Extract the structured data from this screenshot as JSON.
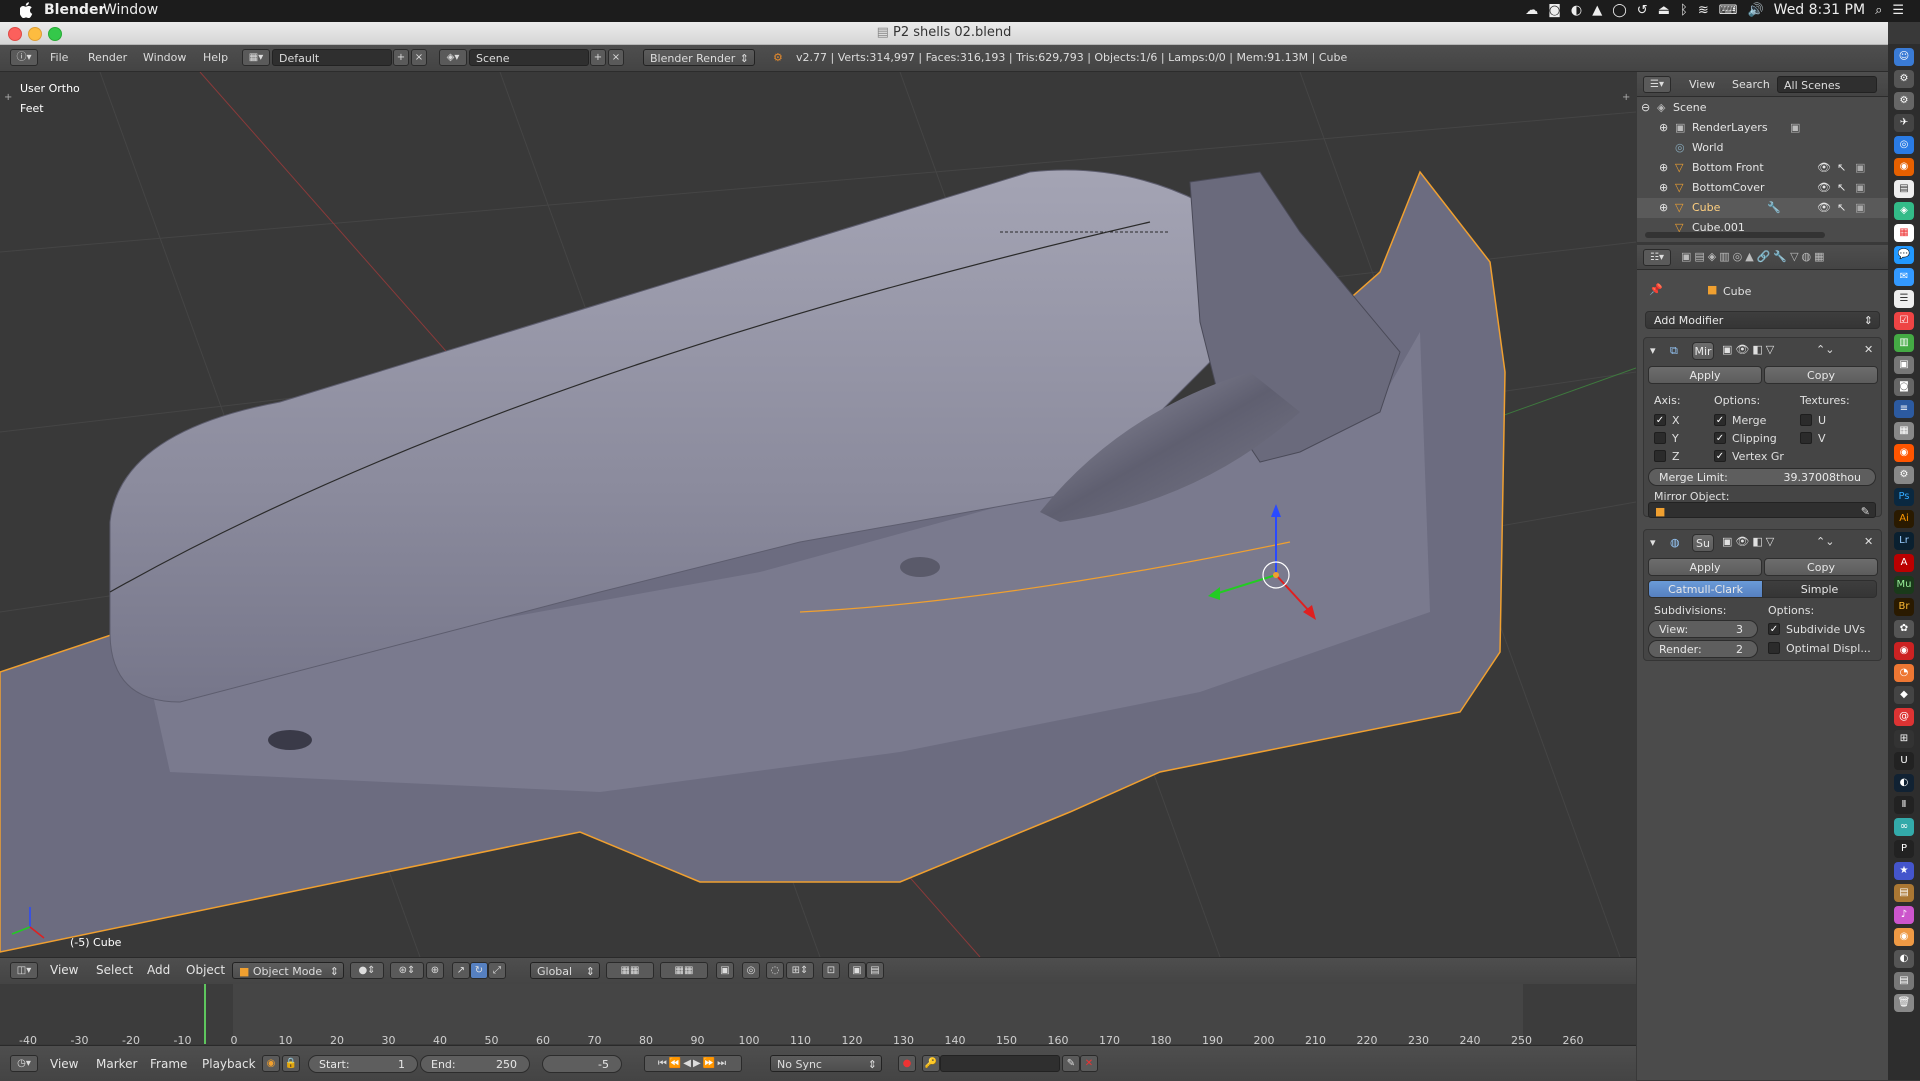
{
  "mac_menubar": {
    "apple": "",
    "app": "Blender",
    "window_menu": "Window",
    "clock": "Wed 8:31 PM"
  },
  "window": {
    "title": "P2 shells 02.blend"
  },
  "top_header": {
    "menus": [
      "File",
      "Render",
      "Window",
      "Help"
    ],
    "layout": "Default",
    "scene": "Scene",
    "engine": "Blender Render",
    "stats": "v2.77 | Verts:314,997 | Faces:316,193 | Tris:629,793 | Objects:1/6 | Lamps:0/0 | Mem:91.13M | Cube"
  },
  "viewport": {
    "view_name": "User Ortho",
    "units": "Feet",
    "object_label": "(-5) Cube",
    "colors": {
      "bg": "#393939",
      "mesh": "#8a8a9c",
      "outline": "#f0a030"
    }
  },
  "viewport_header": {
    "menus": [
      "View",
      "Select",
      "Add",
      "Object"
    ],
    "mode": "Object Mode",
    "orientation": "Global"
  },
  "timeline": {
    "ticks": [
      "-40",
      "-30",
      "-20",
      "-10",
      "0",
      "10",
      "20",
      "30",
      "40",
      "50",
      "60",
      "70",
      "80",
      "90",
      "100",
      "110",
      "120",
      "130",
      "140",
      "150",
      "160",
      "170",
      "180",
      "190",
      "200",
      "210",
      "220",
      "230",
      "240",
      "250",
      "260"
    ],
    "menus": [
      "View",
      "Marker",
      "Frame",
      "Playback"
    ],
    "start_label": "Start:",
    "start": "1",
    "end_label": "End:",
    "end": "250",
    "current": "-5",
    "sync": "No Sync"
  },
  "outliner": {
    "menus": [
      "View",
      "Search"
    ],
    "filter": "All Scenes",
    "items": [
      {
        "label": "Scene",
        "icon": "scene-icon"
      },
      {
        "label": "RenderLayers",
        "icon": "renderlayers-icon"
      },
      {
        "label": "World",
        "icon": "world-icon"
      },
      {
        "label": "Bottom Front",
        "icon": "mesh-icon"
      },
      {
        "label": "BottomCover",
        "icon": "mesh-icon"
      },
      {
        "label": "Cube",
        "icon": "mesh-icon"
      },
      {
        "label": "Cube.001",
        "icon": "mesh-icon"
      }
    ]
  },
  "properties": {
    "context_object": "Cube",
    "add_modifier": "Add Modifier",
    "mirror": {
      "name": "Mir",
      "apply": "Apply",
      "copy": "Copy",
      "axis_label": "Axis:",
      "options_label": "Options:",
      "textures_label": "Textures:",
      "axes": [
        {
          "label": "X",
          "checked": true
        },
        {
          "label": "Y",
          "checked": false
        },
        {
          "label": "Z",
          "checked": false
        }
      ],
      "options": [
        {
          "label": "Merge",
          "checked": true
        },
        {
          "label": "Clipping",
          "checked": true
        },
        {
          "label": "Vertex Gr",
          "checked": true
        }
      ],
      "textures": [
        {
          "label": "U",
          "checked": false
        },
        {
          "label": "V",
          "checked": false
        }
      ],
      "merge_limit_label": "Merge Limit:",
      "merge_limit": "39.37008thou",
      "mirror_object_label": "Mirror Object:"
    },
    "subsurf": {
      "name": "Su",
      "apply": "Apply",
      "copy": "Copy",
      "tab_active": "Catmull-Clark",
      "tab_other": "Simple",
      "subdivisions_label": "Subdivisions:",
      "options_label": "Options:",
      "view_label": "View:",
      "view": "3",
      "render_label": "Render:",
      "render": "2",
      "subdivide_uvs": "Subdivide UVs",
      "subdivide_uvs_checked": true,
      "optimal_display": "Optimal Displ...",
      "optimal_display_checked": false
    }
  }
}
